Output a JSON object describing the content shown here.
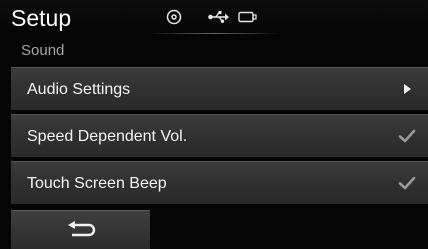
{
  "header": {
    "title": "Setup",
    "status_icons": [
      "disc-icon",
      "usb-icon",
      "ipod-icon"
    ]
  },
  "section": {
    "subtitle": "Sound"
  },
  "menu": {
    "items": [
      {
        "label": "Audio Settings",
        "trail_icon": "arrow-right-icon"
      },
      {
        "label": "Speed Dependent Vol.",
        "trail_icon": "checkmark-icon",
        "checked": true
      },
      {
        "label": "Touch Screen Beep",
        "trail_icon": "checkmark-icon",
        "checked": true
      }
    ]
  },
  "footer": {
    "back_icon": "back-arrow-icon"
  },
  "colors": {
    "background": "#050505",
    "item_bg": "#333333",
    "check": "#9a9a9a",
    "text": "#f4f4f4",
    "subtitle": "#a5a5a5"
  }
}
